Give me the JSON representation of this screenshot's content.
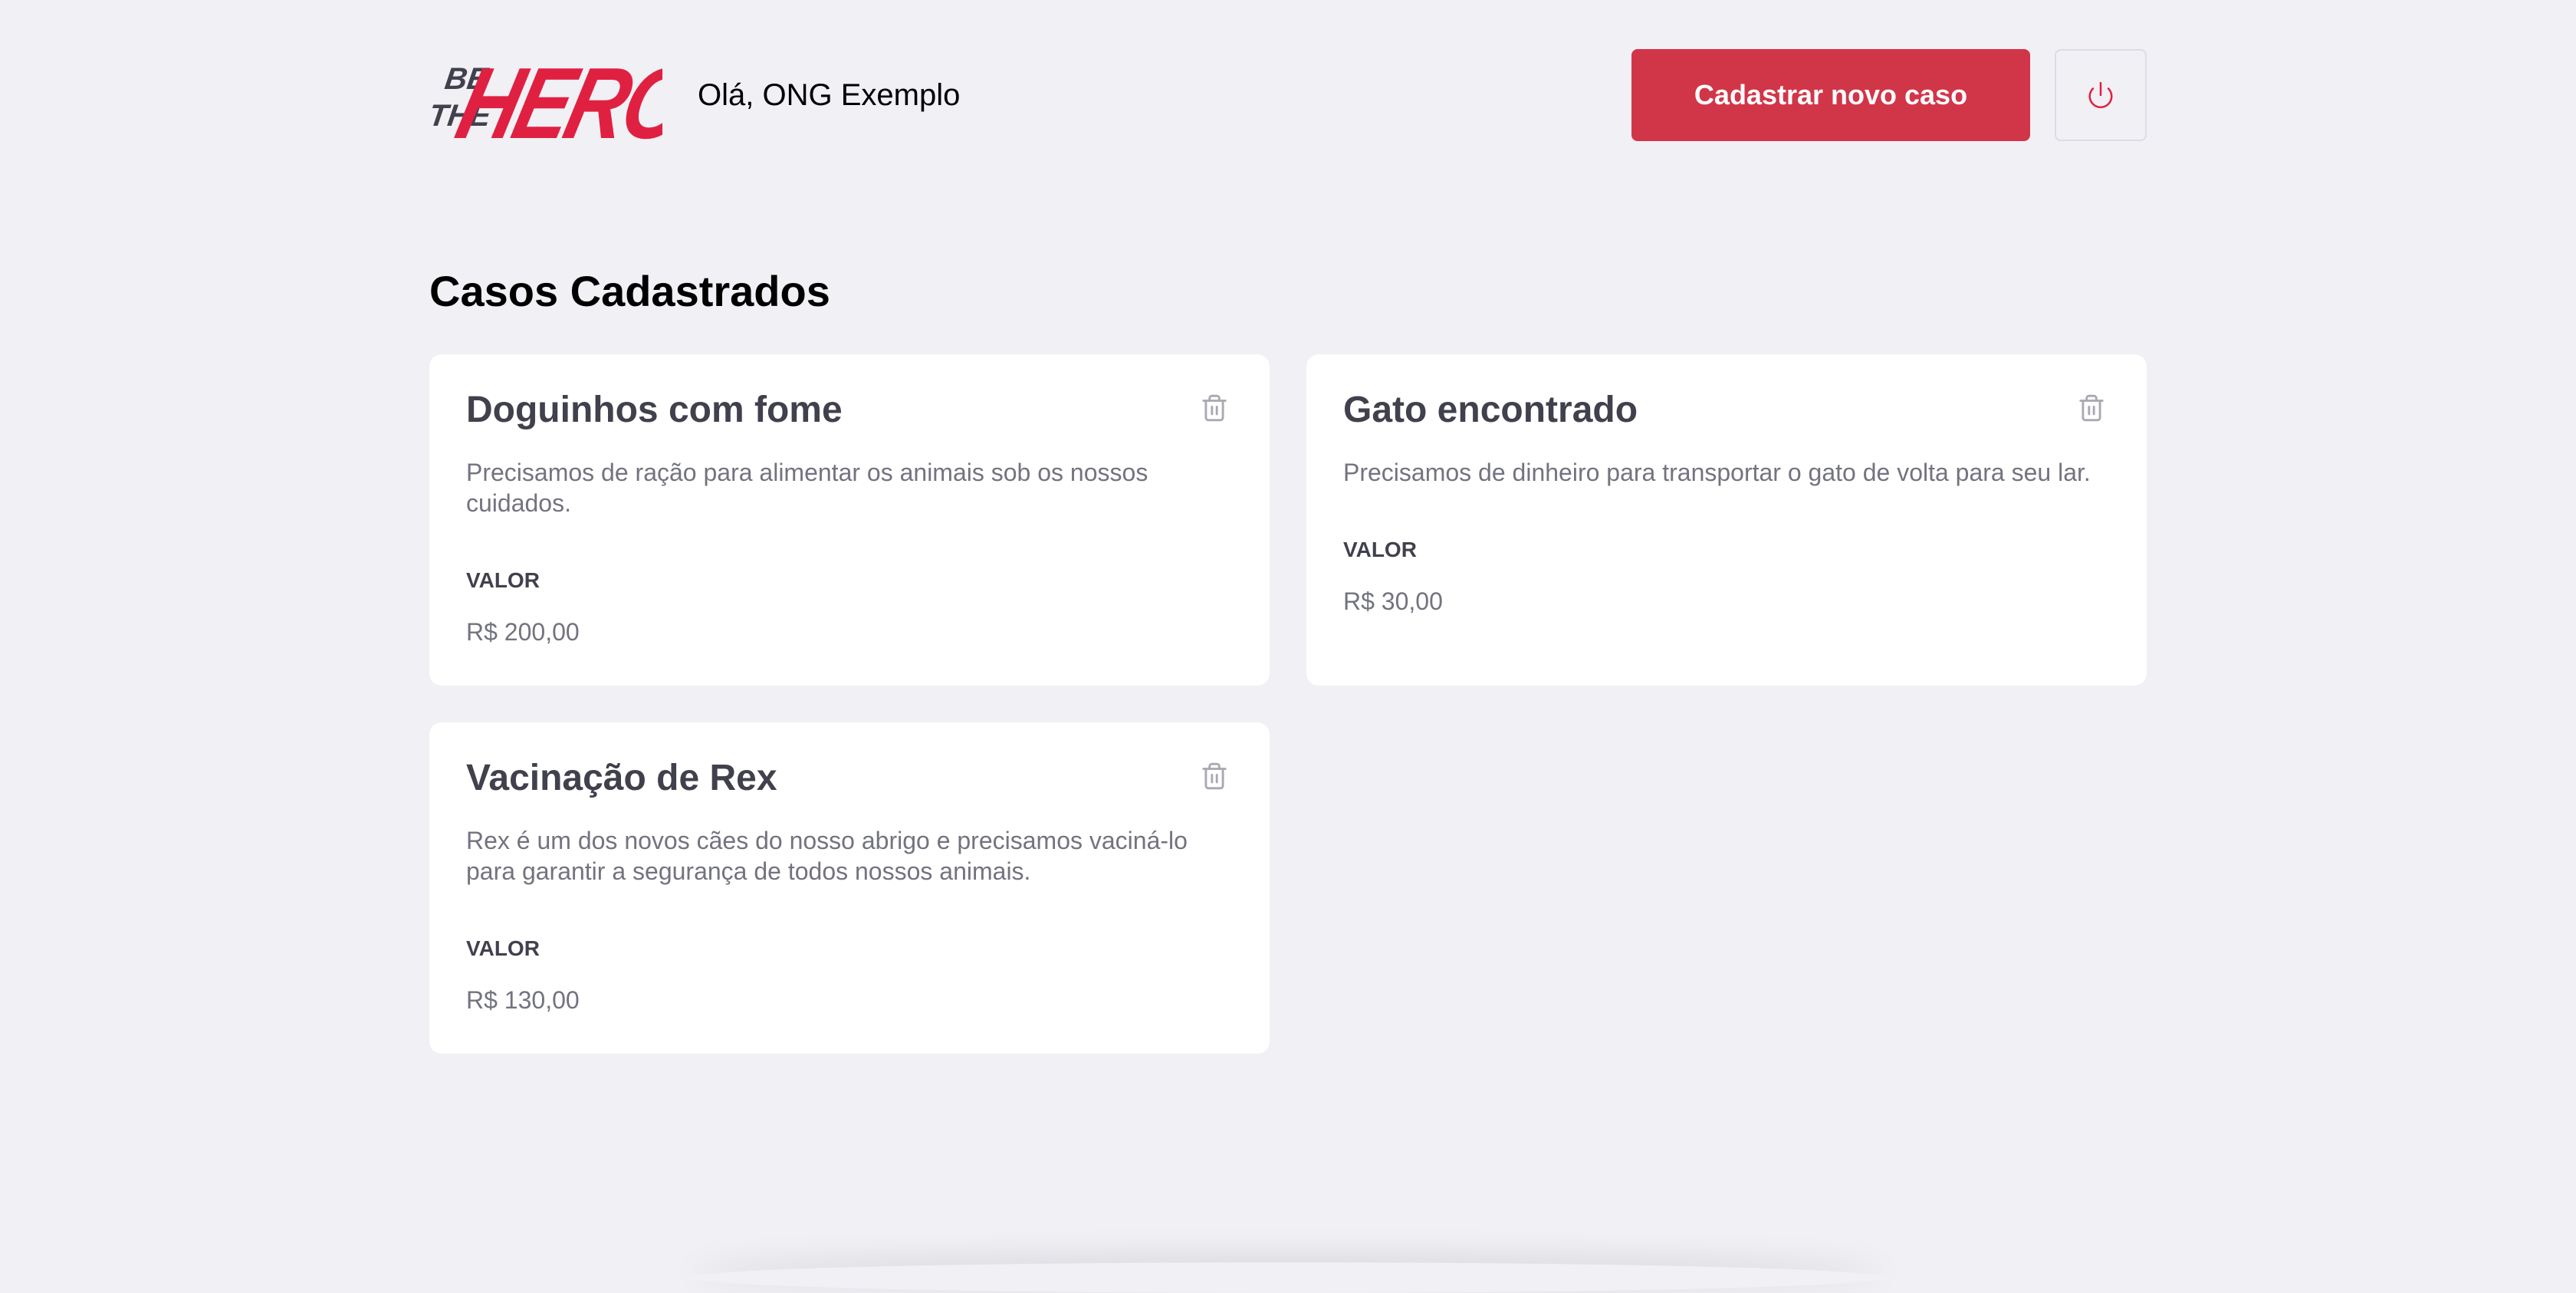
{
  "header": {
    "logo_text": "BE THE HERO",
    "greeting": "Olá, ONG Exemplo",
    "new_case_label": "Cadastrar novo caso",
    "logout_icon": "power-icon"
  },
  "page": {
    "section_title": "Casos Cadastrados"
  },
  "cases": [
    {
      "title": "Doguinhos com fome",
      "description": "Precisamos de ração para alimentar os animais sob os nossos cuidados.",
      "value_label": "VALOR",
      "value": "R$ 200,00"
    },
    {
      "title": "Gato encontrado",
      "description": "Precisamos de dinheiro para transportar o gato de volta para seu lar.",
      "value_label": "VALOR",
      "value": "R$ 30,00"
    },
    {
      "title": "Vacinação de Rex",
      "description": "Rex é um dos novos cães do nosso abrigo e precisamos vaciná-lo para garantir a segurança de todos nossos animais.",
      "value_label": "VALOR",
      "value": "R$ 130,00"
    }
  ],
  "colors": {
    "background": "#f0f0f5",
    "brand_red": "#d13648",
    "text_dark": "#41414d",
    "text_muted": "#737380"
  }
}
